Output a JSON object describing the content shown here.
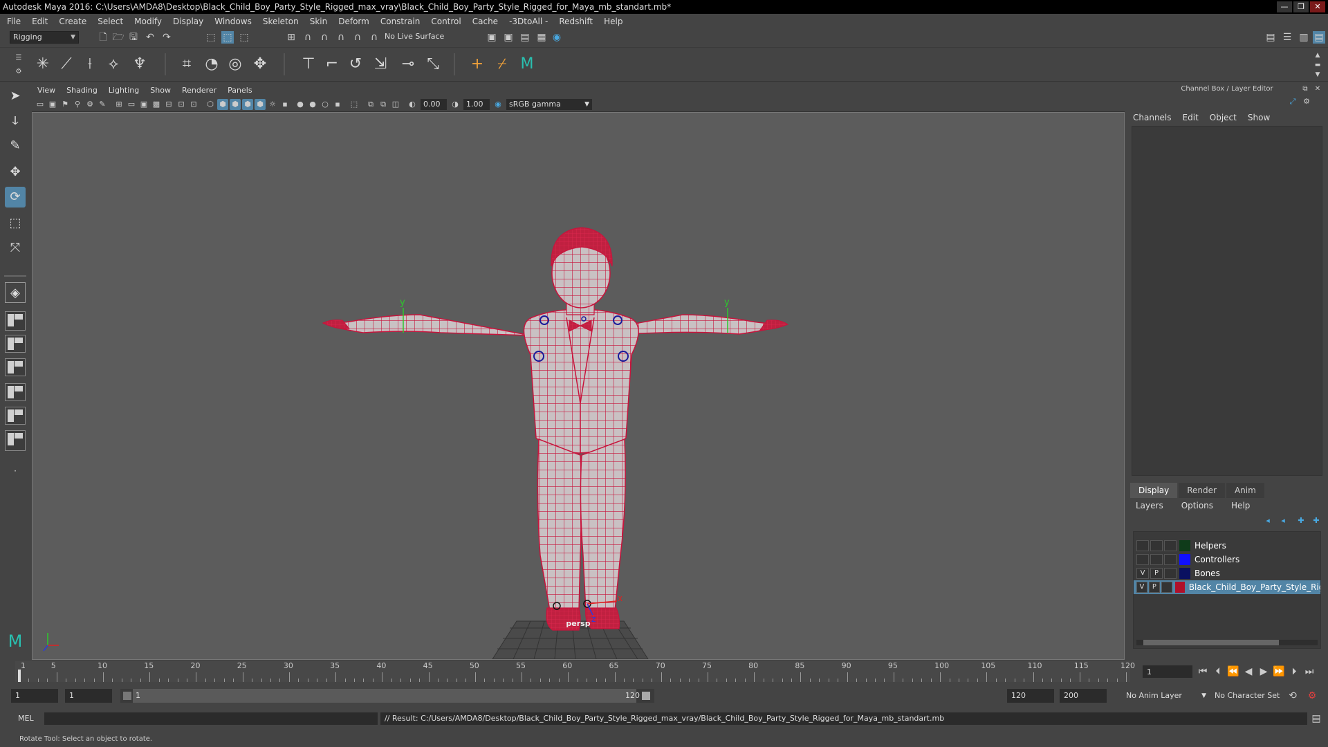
{
  "window": {
    "title": "Autodesk Maya 2016: C:\\Users\\AMDA8\\Desktop\\Black_Child_Boy_Party_Style_Rigged_max_vray\\Black_Child_Boy_Party_Style_Rigged_for_Maya_mb_standart.mb*",
    "minimize": "—",
    "maximize": "❐",
    "close": "✕"
  },
  "menubar": [
    "File",
    "Edit",
    "Create",
    "Select",
    "Modify",
    "Display",
    "Windows",
    "Skeleton",
    "Skin",
    "Deform",
    "Constrain",
    "Control",
    "Cache",
    "-3DtoAll -",
    "Redshift",
    "Help"
  ],
  "statusline": {
    "menu_set": "Rigging",
    "live_surface": "No Live Surface"
  },
  "viewport": {
    "menu": [
      "View",
      "Shading",
      "Lighting",
      "Show",
      "Renderer",
      "Panels"
    ],
    "exposure": "0.00",
    "gamma": "1.00",
    "color_space": "sRGB gamma",
    "camera_label": "persp",
    "axis_y": "y",
    "axis_x": "x",
    "axis_z": "z"
  },
  "channel_box": {
    "title": "Channel Box / Layer Editor",
    "menu": [
      "Channels",
      "Edit",
      "Object",
      "Show"
    ]
  },
  "layer_editor": {
    "tabs": [
      "Display",
      "Render",
      "Anim"
    ],
    "active_tab": "Display",
    "menu": [
      "Layers",
      "Options",
      "Help"
    ],
    "layers": [
      {
        "v": "",
        "p": "",
        "color": "#0f3b1a",
        "name": "Helpers",
        "selected": false
      },
      {
        "v": "",
        "p": "",
        "color": "#1010ff",
        "name": "Controllers",
        "selected": false
      },
      {
        "v": "V",
        "p": "P",
        "color": "#0a1060",
        "name": "Bones",
        "selected": false
      },
      {
        "v": "V",
        "p": "P",
        "color": "#b0102a",
        "name": "Black_Child_Boy_Party_Style_Rigged",
        "selected": true
      }
    ]
  },
  "time_slider": {
    "labels": [
      "1",
      "5",
      "10",
      "15",
      "20",
      "25",
      "30",
      "35",
      "40",
      "45",
      "50",
      "55",
      "60",
      "65",
      "70",
      "75",
      "80",
      "85",
      "90",
      "95",
      "100",
      "105",
      "110",
      "115",
      "120"
    ],
    "current_frame": "1"
  },
  "range_slider": {
    "start": "1",
    "playback_start": "1",
    "range_start_label": "1",
    "range_end_label": "120",
    "playback_end": "120",
    "end": "200",
    "anim_layer": "No Anim Layer",
    "character_set": "No Character Set"
  },
  "command_line": {
    "language": "MEL",
    "result": "// Result: C:/Users/AMDA8/Desktop/Black_Child_Boy_Party_Style_Rigged_max_vray/Black_Child_Boy_Party_Style_Rigged_for_Maya_mb_standart.mb"
  },
  "help_line": "Rotate Tool: Select an object to rotate."
}
